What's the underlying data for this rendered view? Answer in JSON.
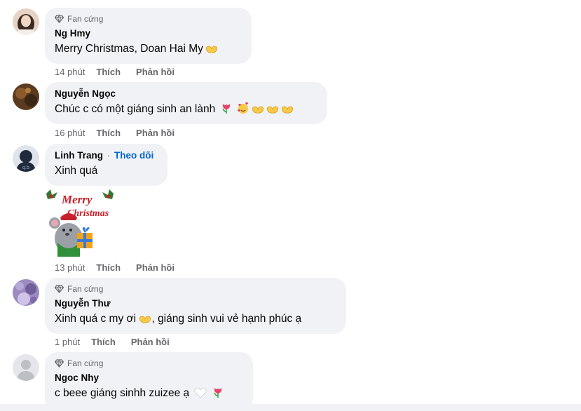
{
  "comments": [
    {
      "badge": "Fan cứng",
      "author": "Ng Hmy",
      "text": "Merry Christmas, Doan Hai My",
      "time": "14 phút",
      "like": "Thích",
      "reply": "Phản hồi",
      "avatar_color": "#c9a98f"
    },
    {
      "author": "Nguyễn Ngọc",
      "text": "Chúc c có một giáng sinh an lành",
      "time": "16 phút",
      "like": "Thích",
      "reply": "Phản hồi",
      "avatar_color": "#6b4a2b"
    },
    {
      "author": "Linh Trang",
      "separator": "·",
      "follow": "Theo dõi",
      "text": "Xinh quá",
      "sticker_title_1": "Merry",
      "sticker_title_2": "Christmas",
      "time": "13 phút",
      "like": "Thích",
      "reply": "Phản hồi",
      "avatar_color": "#1f2a3c"
    },
    {
      "badge": "Fan cứng",
      "author": "Nguyễn Thư",
      "text_part1": "Xinh quá c my ơi",
      "text_part2": ", giáng sinh vui vẻ hạnh phúc ạ",
      "time": "1 phút",
      "like": "Thích",
      "reply": "Phản hồi",
      "avatar_color": "#8d7bb0"
    },
    {
      "badge": "Fan cứng",
      "author": "Ngoc Nhy",
      "text": "c beee giáng sinhh zuizee ạ",
      "avatar_color": "#d7dbe0"
    }
  ],
  "icons": [
    "diamond-icon",
    "heart-hands-emoji",
    "tulip-emoji",
    "smiling-face-with-hearts-emoji",
    "white-heart-emoji"
  ],
  "colors": {
    "bubble": "#f0f2f5",
    "meta": "#65676b",
    "link": "#0064d1"
  }
}
